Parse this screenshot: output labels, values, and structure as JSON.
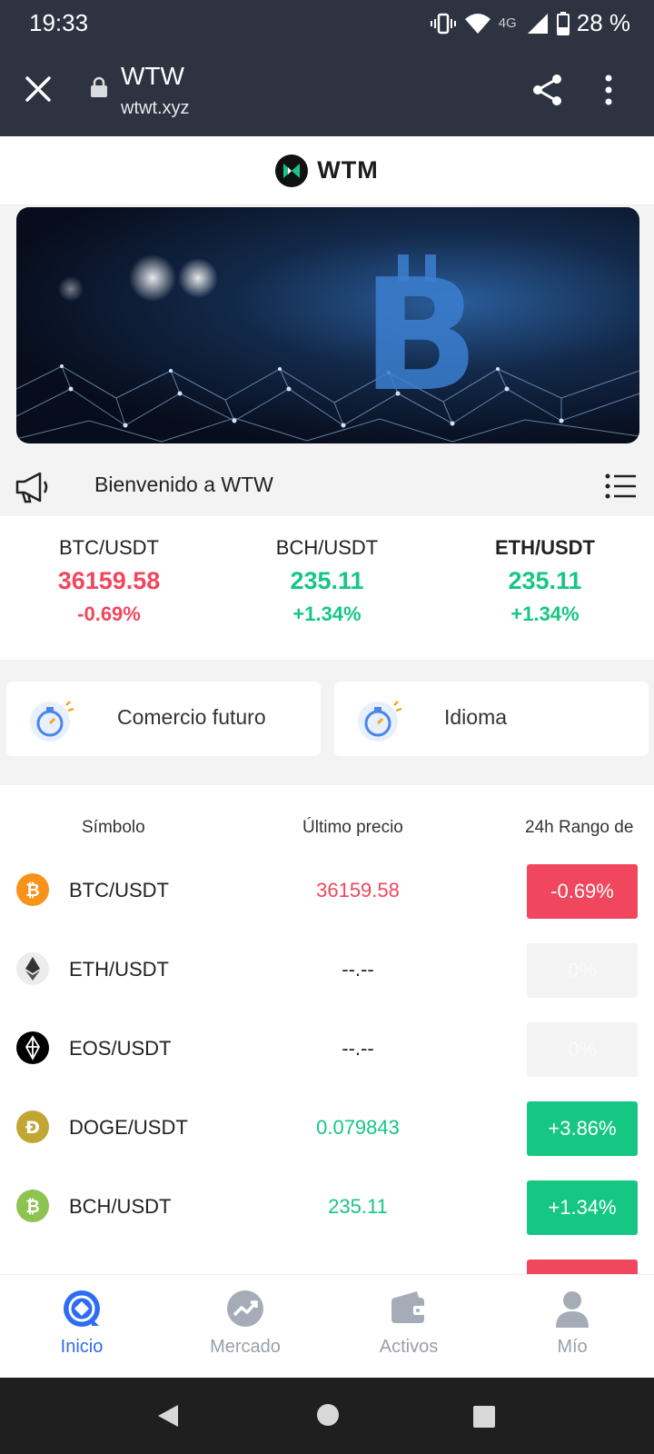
{
  "status_bar": {
    "time": "19:33",
    "network": "4G",
    "battery": "28 %"
  },
  "browser": {
    "title": "WTW",
    "url": "wtwt.xyz"
  },
  "header": {
    "brand": "WTM"
  },
  "notice": {
    "text": "Bienvenido a WTW"
  },
  "ticker": [
    {
      "pair": "BTC/USDT",
      "price": "36159.58",
      "change": "-0.69%",
      "trend": "down"
    },
    {
      "pair": "BCH/USDT",
      "price": "235.11",
      "change": "+1.34%",
      "trend": "up"
    },
    {
      "pair": "ETH/USDT",
      "price": "235.11",
      "change": "+1.34%",
      "trend": "up"
    }
  ],
  "quick_links": [
    {
      "label": "Comercio futuro"
    },
    {
      "label": "Idioma"
    }
  ],
  "table": {
    "headers": {
      "symbol": "Símbolo",
      "price": "Último precio",
      "range": "24h Rango de"
    },
    "rows": [
      {
        "symbol": "BTC/USDT",
        "price": "36159.58",
        "change": "-0.69%",
        "coin_icon": "bitcoin-icon",
        "icon_color": "#f7931a"
      },
      {
        "symbol": "ETH/USDT",
        "price": "--.--",
        "change": "0%",
        "coin_icon": "ethereum-icon",
        "icon_color": "#e6e6e6"
      },
      {
        "symbol": "EOS/USDT",
        "price": "--.--",
        "change": "0%",
        "coin_icon": "eos-icon",
        "icon_color": "#000000"
      },
      {
        "symbol": "DOGE/USDT",
        "price": "0.079843",
        "change": "+3.86%",
        "coin_icon": "dogecoin-icon",
        "icon_color": "#c2a633"
      },
      {
        "symbol": "BCH/USDT",
        "price": "235.11",
        "change": "+1.34%",
        "coin_icon": "bitcoin-cash-icon",
        "icon_color": "#8dc351"
      }
    ]
  },
  "bottom_nav": [
    {
      "label": "Inicio",
      "active": true
    },
    {
      "label": "Mercado",
      "active": false
    },
    {
      "label": "Activos",
      "active": false
    },
    {
      "label": "Mío",
      "active": false
    }
  ],
  "colors": {
    "up": "#16c784",
    "down": "#f0475e",
    "accent": "#2f6cf6",
    "chrome": "#2d3340"
  }
}
